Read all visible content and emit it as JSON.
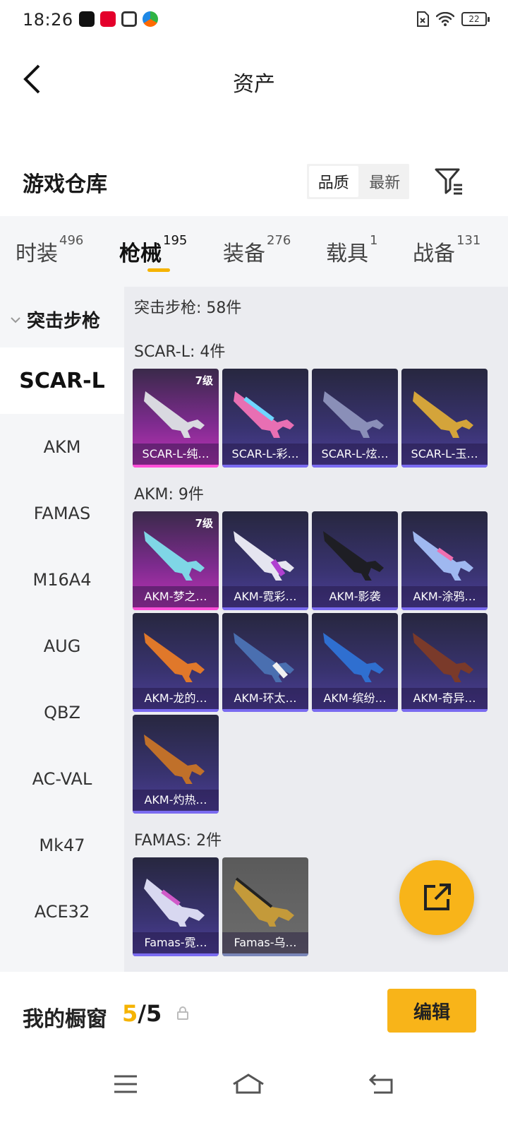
{
  "status": {
    "time": "18:26",
    "battery": "22"
  },
  "header": {
    "title": "资产"
  },
  "warehouse": {
    "title": "游戏仓库",
    "sort": [
      "品质",
      "最新"
    ]
  },
  "tabs": [
    {
      "label": "时装",
      "count": "496"
    },
    {
      "label": "枪械",
      "count": "195"
    },
    {
      "label": "装备",
      "count": "276"
    },
    {
      "label": "载具",
      "count": "1"
    },
    {
      "label": "战备",
      "count": "131"
    }
  ],
  "sidebar": {
    "category": "突击步枪",
    "items": [
      "SCAR-L",
      "AKM",
      "FAMAS",
      "M16A4",
      "AUG",
      "QBZ",
      "AC-VAL",
      "Mk47",
      "ACE32"
    ]
  },
  "content": {
    "count": "突击步枪: 58件",
    "groups": [
      {
        "label": "SCAR-L: 4件",
        "items": [
          "SCAR-L-纯…",
          "SCAR-L-彩…",
          "SCAR-L-炫…",
          "SCAR-L-玉…"
        ]
      },
      {
        "label": "AKM: 9件",
        "items": [
          "AKM-梦之…",
          "AKM-霓彩…",
          "AKM-影袭",
          "AKM-涂鸦…",
          "AKM-龙的…",
          "AKM-环太…",
          "AKM-缤纷…",
          "AKM-奇异…",
          "AKM-灼热…"
        ]
      },
      {
        "label": "FAMAS: 2件",
        "items": [
          "Famas-霓…",
          "Famas-乌…"
        ]
      }
    ],
    "level_badge": "7级"
  },
  "showcase": {
    "label": "我的橱窗",
    "current": "5",
    "total": "/5",
    "edit": "编辑"
  },
  "colors": {
    "accent": "#f8b419",
    "tab_indicator": "#f5b301"
  }
}
